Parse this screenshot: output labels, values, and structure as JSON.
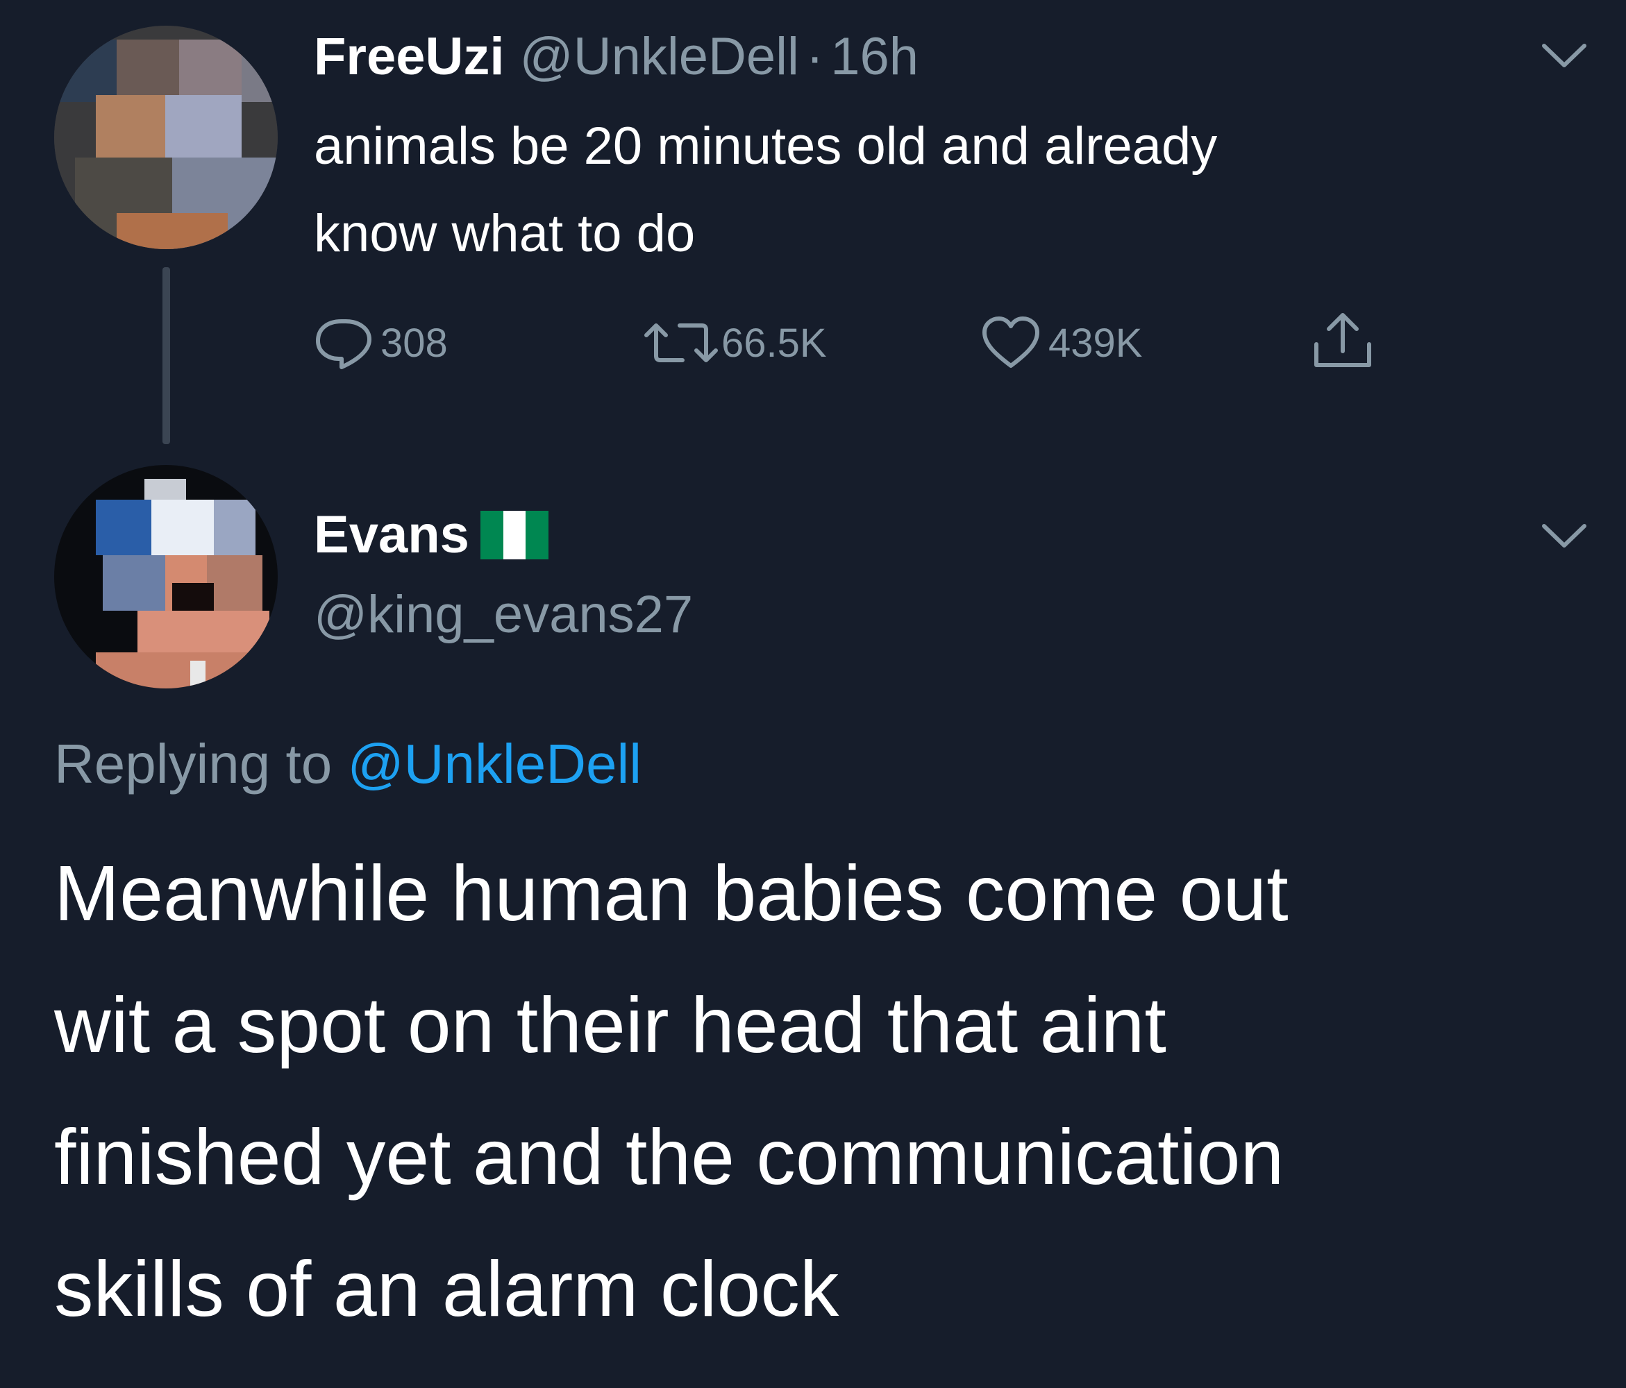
{
  "original_tweet": {
    "display_name": "FreeUzi",
    "handle": "@UnkleDell",
    "separator": "·",
    "time": "16h",
    "text_lines": [
      "animals be 20 minutes old and already",
      "know what to do"
    ],
    "actions": {
      "replies": "308",
      "retweets": "66.5K",
      "likes": "439K"
    },
    "icons": {
      "reply": "comment-icon",
      "retweet": "retweet-icon",
      "like": "heart-icon",
      "share": "share-icon",
      "menu": "chevron-down-icon"
    }
  },
  "reply_tweet": {
    "display_name": "Evans",
    "flag": "nigeria-flag-icon",
    "handle": "@king_evans27",
    "replying_to_label": "Replying to",
    "replying_to_handle": "@UnkleDell",
    "text_lines": [
      "Meanwhile human babies come out",
      "wit a spot on their head that aint",
      "finished yet and the communication",
      "skills of an alarm clock"
    ],
    "icons": {
      "menu": "chevron-down-icon"
    }
  },
  "colors": {
    "background": "#161d2b",
    "text": "#ffffff",
    "secondary": "#8899a6",
    "link": "#1da1f2",
    "flag_green": "#008751"
  }
}
